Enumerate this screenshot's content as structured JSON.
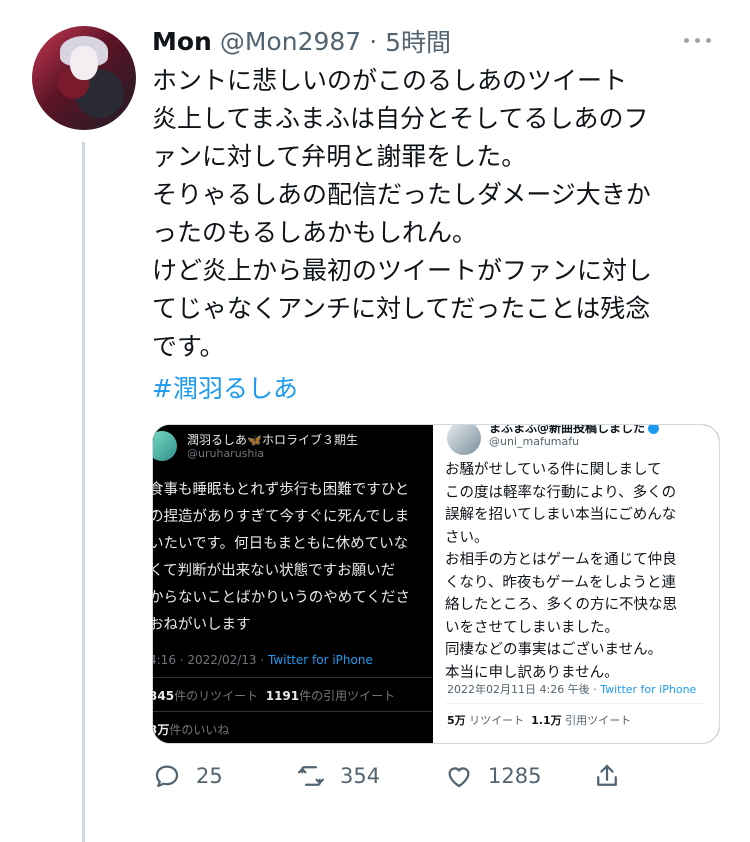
{
  "author": {
    "name": "Mon",
    "handle": "@Mon2987",
    "separator": "·",
    "time": "5時間"
  },
  "tweet": {
    "lines": [
      "ホントに悲しいのがこのるしあのツイート",
      "炎上してまふまふは自分とそしてるしあのフ",
      "ァンに対して弁明と謝罪をした。",
      "そりゃるしあの配信だったしダメージ大きか",
      "ったのもるしあかもしれん。",
      "けど炎上から最初のツイートがファンに対し",
      "てじゃなくアンチに対してだったことは残念",
      "です。"
    ],
    "hashtag": "#潤羽るしあ"
  },
  "media": {
    "left": {
      "name": "潤羽るしあ🦋ホロライブ３期生",
      "handle": "@uruharushia",
      "lines": [
        "食事も睡眠もとれず歩行も困難ですひと",
        "の捏造がありすぎて今すぐに死んでしま",
        "いたいです。何日もまともに休めていな",
        "くて判断が出来ない状態ですお願いだ",
        "からないことばかりいうのやめてくださ",
        "おねがいします"
      ],
      "time": "4:16 · 2022/02/13 · ",
      "source": "Twitter for iPhone",
      "retweets": "345",
      "retweets_label": "件のリツイート",
      "quotes": "1191",
      "quotes_label": "件の引用ツイート",
      "likes": "3万",
      "likes_label": "件のいいね"
    },
    "right": {
      "name": "まふまふ@新曲投稿しました",
      "handle": "@uni_mafumafu",
      "lines": [
        "お騒がせしている件に関しまして",
        "この度は軽率な行動により、多くの",
        "誤解を招いてしまい本当にごめんな",
        "さい。",
        "お相手の方とはゲームを通じて仲良",
        "くなり、昨夜もゲームをしようと連",
        "絡したところ、多くの方に不快な思",
        "いをさせてしまいました。",
        "同棲などの事実はございません。",
        "本当に申し訳ありません。"
      ],
      "time": "2022年02月11日 4:26 午後 · ",
      "source": "Twitter for iPhone",
      "retweets": "5万",
      "retweets_label": " リツイート",
      "quotes": "1.1万",
      "quotes_label": " 引用ツイート"
    }
  },
  "actions": {
    "reply_count": "25",
    "retweet_count": "354",
    "like_count": "1285"
  },
  "icons": [
    "reply-icon",
    "retweet-icon",
    "like-icon",
    "share-icon",
    "more-icon"
  ],
  "colors": {
    "link": "#1d9bf0",
    "muted": "#536471"
  }
}
